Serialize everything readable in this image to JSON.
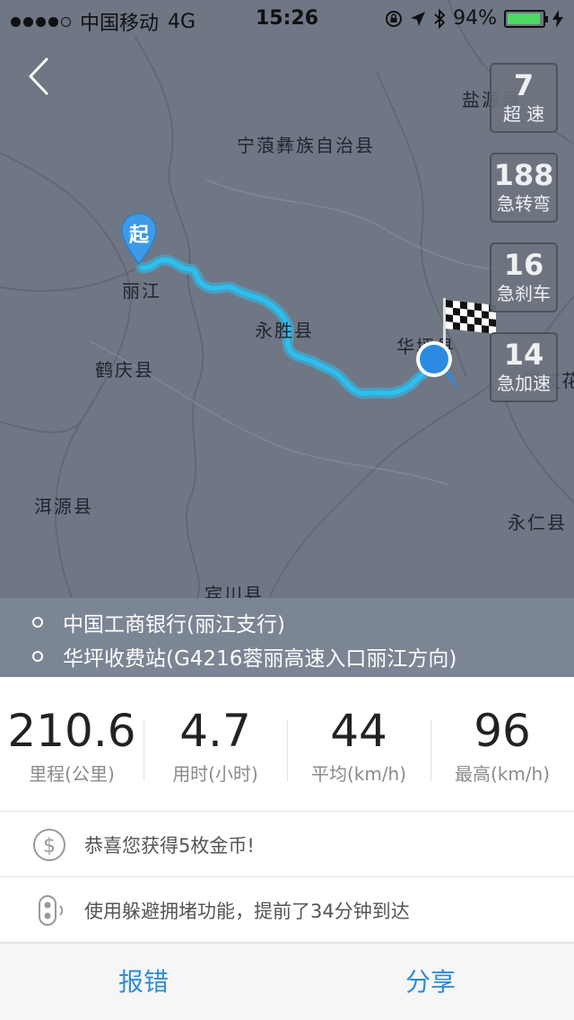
{
  "status_bar": {
    "carrier": "中国移动",
    "network": "4G",
    "time": "15:26",
    "battery": "94%",
    "battery_level": 0.94,
    "battery_color": "#4cd964"
  },
  "map": {
    "back_icon": "chevron-left-icon",
    "start_marker_label": "起",
    "labels": {
      "yanyuan": "盐源县",
      "ninglang": "宁蒗彝族自治县",
      "lijiang": "丽江",
      "yongsheng": "永胜县",
      "huaping": "华坪县",
      "heqing": "鹤庆县",
      "panzhihua": "攀枝花",
      "eryuan": "洱源县",
      "yongren": "永仁县",
      "binchuan": "宾川县"
    },
    "route_color": "#2cc0f0"
  },
  "stat_boxes": [
    {
      "value": "7",
      "label": "超 速"
    },
    {
      "value": "188",
      "label": "急转弯"
    },
    {
      "value": "16",
      "label": "急刹车"
    },
    {
      "value": "14",
      "label": "急加速"
    }
  ],
  "places": [
    "中国工商银行(丽江支行)",
    "华坪收费站(G4216蓉丽高速入口丽江方向)"
  ],
  "metrics": [
    {
      "value": "210.6",
      "label": "里程(公里)"
    },
    {
      "value": "4.7",
      "label": "用时(小时)"
    },
    {
      "value": "44",
      "label": "平均(km/h)"
    },
    {
      "value": "96",
      "label": "最高(km/h)"
    }
  ],
  "info": {
    "coins_text": "恭喜您获得5枚金币!",
    "congestion_text": "使用躲避拥堵功能，提前了34分钟到达"
  },
  "actions": {
    "report_label": "报错",
    "share_label": "分享"
  }
}
